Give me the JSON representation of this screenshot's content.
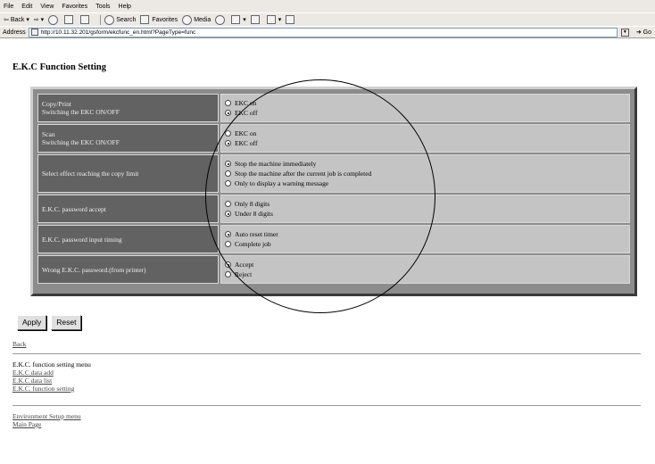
{
  "browser": {
    "menu": [
      "File",
      "Edit",
      "View",
      "Favorites",
      "Tools",
      "Help"
    ],
    "toolbar": {
      "back": "Back",
      "search": "Search",
      "favorites": "Favorites",
      "media": "Media"
    },
    "address_label": "Address",
    "address_url": "http://10.11.32.201/gsform/ekcfunc_en.html?PageType=func",
    "go_label": "Go"
  },
  "page": {
    "title": "E.K.C Function Setting",
    "rows": [
      {
        "label_lines": [
          "Copy/Print",
          "Switching the EKC ON/OFF"
        ],
        "options": [
          {
            "text": "EKC on",
            "checked": false
          },
          {
            "text": "EKC off",
            "checked": true
          }
        ]
      },
      {
        "label_lines": [
          "Scan",
          "Switching the EKC ON/OFF"
        ],
        "options": [
          {
            "text": "EKC on",
            "checked": false
          },
          {
            "text": "EKC off",
            "checked": true
          }
        ]
      },
      {
        "label_lines": [
          "Select effect reaching the copy limit"
        ],
        "options": [
          {
            "text": "Stop the machine immediately",
            "checked": true
          },
          {
            "text": "Stop the machine after the current job is completed",
            "checked": false
          },
          {
            "text": "Only to display a warning message",
            "checked": false
          }
        ]
      },
      {
        "label_lines": [
          "E.K.C. password accept"
        ],
        "options": [
          {
            "text": "Only 8 digits",
            "checked": false
          },
          {
            "text": "Under 8 digits",
            "checked": true
          }
        ]
      },
      {
        "label_lines": [
          "E.K.C. password input timing"
        ],
        "options": [
          {
            "text": "Auto reset timer",
            "checked": true
          },
          {
            "text": "Complete job",
            "checked": false
          }
        ]
      },
      {
        "label_lines": [
          "Wrong E.K.C. password.(from printer)"
        ],
        "options": [
          {
            "text": "Accept",
            "checked": true
          },
          {
            "text": "Reject",
            "checked": false
          }
        ]
      }
    ],
    "apply_label": "Apply",
    "reset_label": "Reset",
    "back_link": "Back",
    "ekc_menu_title": "E.K.C. function setting menu",
    "ekc_menu_links": [
      "E.K.C data add",
      "E.K.C data list",
      "E.K.C. function setting"
    ],
    "bottom_links": [
      "Environment Setup menu",
      "Main Page"
    ]
  }
}
